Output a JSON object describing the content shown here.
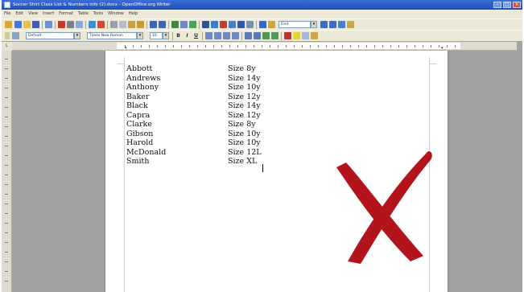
{
  "window": {
    "title": "Soccer Shirt Class List & Numbers info (2).docx - OpenOffice.org Writer"
  },
  "menu": [
    "File",
    "Edit",
    "View",
    "Insert",
    "Format",
    "Table",
    "Tools",
    "Window",
    "Help"
  ],
  "formatting": {
    "paragraph_style": "Default",
    "font_name": "Times New Roman",
    "font_size": "10"
  },
  "document": {
    "rows": [
      {
        "name": "Abbott",
        "size": "Size 8y"
      },
      {
        "name": "Andrews",
        "size": "Size 14y"
      },
      {
        "name": "Anthony",
        "size": "Size 10y"
      },
      {
        "name": "Baker",
        "size": "Size 12y"
      },
      {
        "name": "Black",
        "size": "Size 14y"
      },
      {
        "name": "Capra",
        "size": "Size 12y"
      },
      {
        "name": "Clarke",
        "size": "Size 8y"
      },
      {
        "name": "Gibson",
        "size": "Size 10y"
      },
      {
        "name": "Harold",
        "size": "Size 10y"
      },
      {
        "name": "McDonald",
        "size": "Size 12L"
      },
      {
        "name": "Smith",
        "size": "Size XL"
      }
    ]
  },
  "overlay": {
    "icon": "red-x-mark",
    "color": "#b3141c"
  }
}
